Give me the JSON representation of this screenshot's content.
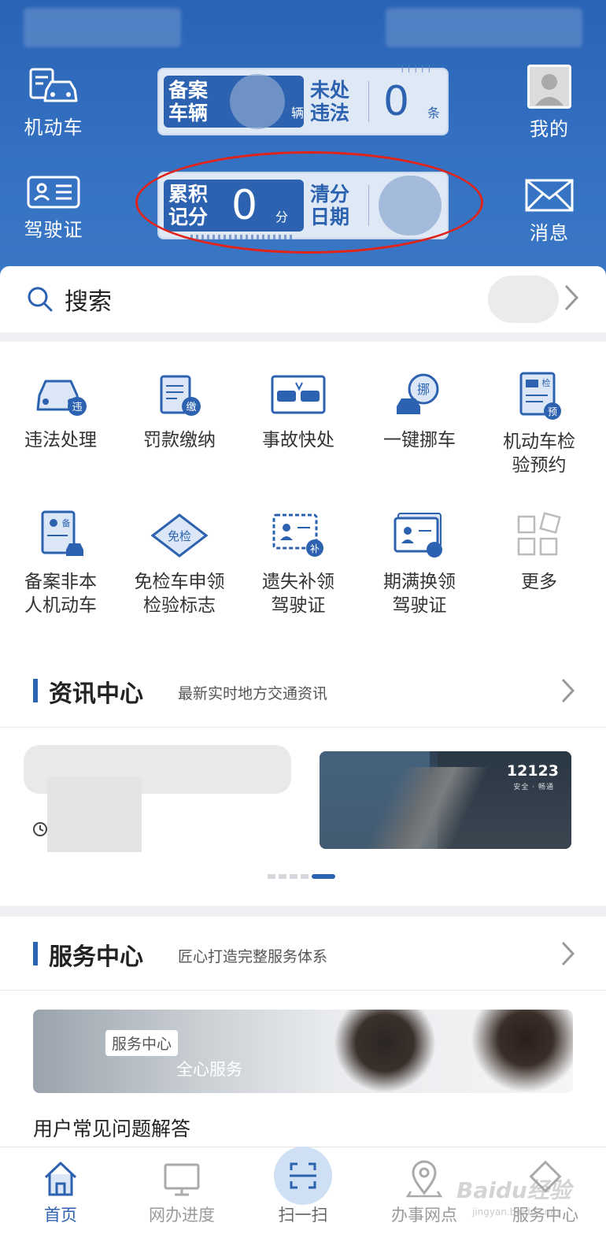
{
  "header": {
    "left_items": [
      {
        "label": "机动车",
        "icon": "vehicle-icon"
      },
      {
        "label": "驾驶证",
        "icon": "license-card-icon"
      }
    ],
    "right_items": [
      {
        "label": "我的",
        "icon": "avatar-icon"
      },
      {
        "label": "消息",
        "icon": "envelope-icon"
      }
    ],
    "card_vehicle": {
      "label_a": "备案\n车辆",
      "unit_a": "辆",
      "label_b": "未处\n违法",
      "value_b": "0",
      "unit_b": "条"
    },
    "card_points": {
      "label_a": "累积\n记分",
      "value_a": "0",
      "unit_a": "分",
      "label_b": "清分\n日期"
    }
  },
  "search": {
    "placeholder": "搜索"
  },
  "services": [
    {
      "label": "违法处理",
      "icon": "violation-car-icon"
    },
    {
      "label": "罚款缴纳",
      "icon": "fine-payment-icon"
    },
    {
      "label": "事故快处",
      "icon": "accident-icon"
    },
    {
      "label": "一键挪车",
      "icon": "move-car-icon"
    },
    {
      "label": "机动车检\n验预约",
      "icon": "inspection-appointment-icon"
    },
    {
      "label": "备案非本\n人机动车",
      "icon": "register-other-vehicle-icon"
    },
    {
      "label": "免检车申领\n检验标志",
      "icon": "exempt-inspection-icon"
    },
    {
      "label": "遗失补领\n驾驶证",
      "icon": "replace-license-icon"
    },
    {
      "label": "期满换领\n驾驶证",
      "icon": "renew-license-icon"
    },
    {
      "label": "更多",
      "icon": "more-grid-icon"
    }
  ],
  "news": {
    "title": "资讯中心",
    "subtitle": "最新实时地方交通资讯",
    "image_brand": "12123",
    "image_brand_sub": "安全 · 畅通"
  },
  "service_center": {
    "title": "服务中心",
    "subtitle": "匠心打造完整服务体系",
    "banner_tag": "服务中心",
    "banner_slogan": "全心服务",
    "faq": "用户常见问题解答"
  },
  "tabbar": [
    {
      "label": "首页",
      "icon": "home-icon",
      "active": true
    },
    {
      "label": "网办进度",
      "icon": "monitor-icon",
      "active": false
    },
    {
      "label": "扫一扫",
      "icon": "scan-icon",
      "active": false
    },
    {
      "label": "办事网点",
      "icon": "location-pin-icon",
      "active": false
    },
    {
      "label": "服务中心",
      "icon": "service-center-icon",
      "active": false
    }
  ],
  "watermark": "Baidu经验",
  "watermark_sub": "jingyan.baidu.com",
  "colors": {
    "primary": "#2c62b0",
    "header_bg": "#3471c2",
    "highlight_ellipse": "#e2231a"
  }
}
